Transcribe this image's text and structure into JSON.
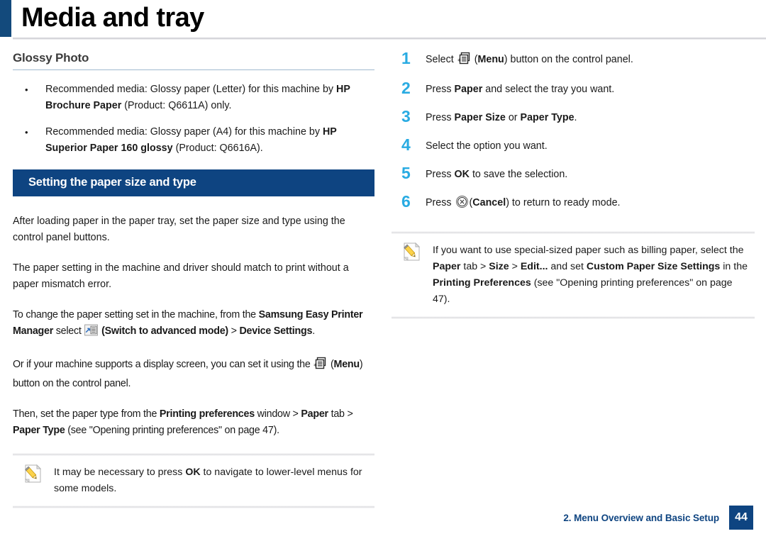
{
  "header": {
    "title": "Media and tray",
    "accent_color": "#134a7c"
  },
  "left_column": {
    "subheading": "Glossy Photo",
    "bullets": [
      {
        "marker": "•",
        "parts": [
          {
            "text": "Recommended media: Glossy paper (Letter) for this machine by ",
            "bold": false
          },
          {
            "text": "HP Brochure Paper",
            "bold": true
          },
          {
            "text": " (Product: Q6611A) only.",
            "bold": false
          }
        ]
      },
      {
        "marker": "•",
        "parts": [
          {
            "text": "Recommended media: Glossy paper (A4) for this machine by ",
            "bold": false
          },
          {
            "text": "HP Superior Paper 160 glossy",
            "bold": true
          },
          {
            "text": " (Product: Q6616A).",
            "bold": false
          }
        ]
      }
    ],
    "section_bar": "Setting the paper size and type",
    "paragraphs": [
      {
        "parts": [
          {
            "text": "After loading paper in the paper tray, set the paper size and type using the control panel buttons.",
            "bold": false
          }
        ]
      },
      {
        "parts": [
          {
            "text": "The paper setting in the machine and driver should match to print without a paper mismatch error.",
            "bold": false
          }
        ]
      },
      {
        "parts": [
          {
            "text": "To change the paper setting set in the machine, from the ",
            "bold": false
          },
          {
            "text": "Samsung Easy Printer Manager",
            "bold": true
          },
          {
            "text": "  select  ",
            "bold": false
          },
          {
            "icon": "switch-advanced-mode-icon"
          },
          {
            "text": " ",
            "bold": false
          },
          {
            "text": "(Switch to advanced mode)",
            "bold": true
          },
          {
            "text": "  >  ",
            "bold": false
          },
          {
            "text": "Device Settings",
            "bold": true
          },
          {
            "text": ".",
            "bold": false
          }
        ]
      },
      {
        "parts": [
          {
            "text": "Or if your machine supports a display screen, you can set it using the ",
            "bold": false
          },
          {
            "icon": "menu-button-icon"
          },
          {
            "text": " (",
            "bold": false
          },
          {
            "text": "Menu",
            "bold": true
          },
          {
            "text": ") button on the control panel.",
            "bold": false
          }
        ]
      },
      {
        "parts": [
          {
            "text": "Then, set the paper type from the ",
            "bold": false
          },
          {
            "text": "Printing preferences",
            "bold": true
          },
          {
            "text": " window > ",
            "bold": false
          },
          {
            "text": "Paper",
            "bold": true
          },
          {
            "text": " tab > ",
            "bold": false
          },
          {
            "text": "Paper Type",
            "bold": true
          },
          {
            "text": " (see \"Opening printing preferences\" on page 47).",
            "bold": false
          }
        ]
      }
    ],
    "note": {
      "icon": "note-pencil-icon",
      "parts": [
        {
          "text": "It may be necessary to press ",
          "bold": false
        },
        {
          "text": "OK",
          "bold": true
        },
        {
          "text": " to navigate to lower-level menus for some models.",
          "bold": false
        }
      ]
    }
  },
  "right_column": {
    "step_number_color": "#29abe2",
    "steps": [
      {
        "number": "1",
        "parts": [
          {
            "text": "Select ",
            "bold": false
          },
          {
            "icon": "menu-button-icon"
          },
          {
            "text": " (",
            "bold": false
          },
          {
            "text": "Menu",
            "bold": true
          },
          {
            "text": ") button on the control panel.",
            "bold": false
          }
        ]
      },
      {
        "number": "2",
        "parts": [
          {
            "text": "Press ",
            "bold": false
          },
          {
            "text": "Paper",
            "bold": true
          },
          {
            "text": " and select the tray you want.",
            "bold": false
          }
        ]
      },
      {
        "number": "3",
        "parts": [
          {
            "text": "Press ",
            "bold": false
          },
          {
            "text": "Paper Size",
            "bold": true
          },
          {
            "text": " or ",
            "bold": false
          },
          {
            "text": "Paper Type",
            "bold": true
          },
          {
            "text": ".",
            "bold": false
          }
        ]
      },
      {
        "number": "4",
        "parts": [
          {
            "text": "Select the option you want.",
            "bold": false
          }
        ]
      },
      {
        "number": "5",
        "parts": [
          {
            "text": "Press ",
            "bold": false
          },
          {
            "text": "OK",
            "bold": true
          },
          {
            "text": " to save the selection.",
            "bold": false
          }
        ]
      },
      {
        "number": "6",
        "parts": [
          {
            "text": "Press ",
            "bold": false
          },
          {
            "icon": "cancel-button-icon"
          },
          {
            "text": "(",
            "bold": false
          },
          {
            "text": "Cancel",
            "bold": true
          },
          {
            "text": ") to return to ready mode.",
            "bold": false
          }
        ]
      }
    ],
    "note": {
      "icon": "note-pencil-icon",
      "parts": [
        {
          "text": "If you want to use special-sized paper such as billing paper, select the ",
          "bold": false
        },
        {
          "text": "Paper",
          "bold": true
        },
        {
          "text": " tab > ",
          "bold": false
        },
        {
          "text": "Size",
          "bold": true
        },
        {
          "text": " > ",
          "bold": false
        },
        {
          "text": "Edit...",
          "bold": true
        },
        {
          "text": " and set ",
          "bold": false
        },
        {
          "text": "Custom  Paper Size Settings",
          "bold": true
        },
        {
          "text": " in the ",
          "bold": false
        },
        {
          "text": "Printing Preferences",
          "bold": true
        },
        {
          "text": " (see \"Opening printing preferences\" on page 47).",
          "bold": false
        }
      ]
    }
  },
  "footer": {
    "label": "2. Menu Overview and Basic Setup",
    "page_number": "44",
    "color": "#0e4481"
  }
}
